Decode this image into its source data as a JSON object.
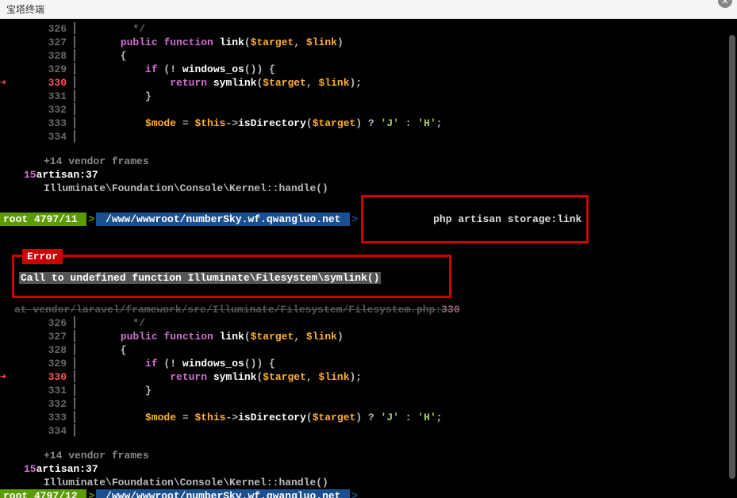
{
  "title_bar": {
    "title": "宝塔终端",
    "close_icon": "✕"
  },
  "code_block_1": {
    "lines": [
      {
        "num": "326",
        "arrow": false,
        "content": "        */"
      },
      {
        "num": "327",
        "arrow": false,
        "tokens": [
          {
            "t": "      ",
            "c": ""
          },
          {
            "t": "public",
            "c": "kw"
          },
          {
            "t": " ",
            "c": ""
          },
          {
            "t": "function",
            "c": "kw"
          },
          {
            "t": " ",
            "c": ""
          },
          {
            "t": "link",
            "c": "fn"
          },
          {
            "t": "(",
            "c": "punct"
          },
          {
            "t": "$target",
            "c": "var"
          },
          {
            "t": ", ",
            "c": "punct"
          },
          {
            "t": "$link",
            "c": "var"
          },
          {
            "t": ")",
            "c": "punct"
          }
        ]
      },
      {
        "num": "328",
        "arrow": false,
        "tokens": [
          {
            "t": "      {",
            "c": "punct"
          }
        ]
      },
      {
        "num": "329",
        "arrow": false,
        "tokens": [
          {
            "t": "          ",
            "c": ""
          },
          {
            "t": "if",
            "c": "kw"
          },
          {
            "t": " (! ",
            "c": "punct"
          },
          {
            "t": "windows_os",
            "c": "fn"
          },
          {
            "t": "()) {",
            "c": "punct"
          }
        ]
      },
      {
        "num": "330",
        "arrow": true,
        "tokens": [
          {
            "t": "              ",
            "c": ""
          },
          {
            "t": "return",
            "c": "kw"
          },
          {
            "t": " ",
            "c": ""
          },
          {
            "t": "symlink",
            "c": "fn"
          },
          {
            "t": "(",
            "c": "punct"
          },
          {
            "t": "$target",
            "c": "var"
          },
          {
            "t": ", ",
            "c": "punct"
          },
          {
            "t": "$link",
            "c": "var"
          },
          {
            "t": ");",
            "c": "punct"
          }
        ]
      },
      {
        "num": "331",
        "arrow": false,
        "tokens": [
          {
            "t": "          }",
            "c": "punct"
          }
        ]
      },
      {
        "num": "332",
        "arrow": false,
        "tokens": []
      },
      {
        "num": "333",
        "arrow": false,
        "tokens": [
          {
            "t": "          ",
            "c": ""
          },
          {
            "t": "$mode",
            "c": "var"
          },
          {
            "t": " = ",
            "c": "op"
          },
          {
            "t": "$this",
            "c": "var"
          },
          {
            "t": "->",
            "c": "op"
          },
          {
            "t": "isDirectory",
            "c": "fn"
          },
          {
            "t": "(",
            "c": "punct"
          },
          {
            "t": "$target",
            "c": "var"
          },
          {
            "t": ") ? ",
            "c": "punct"
          },
          {
            "t": "'J'",
            "c": "str"
          },
          {
            "t": " : ",
            "c": "punct"
          },
          {
            "t": "'H'",
            "c": "str"
          },
          {
            "t": ";",
            "c": "punct"
          }
        ]
      },
      {
        "num": "334",
        "arrow": false,
        "tokens": []
      }
    ]
  },
  "trace_1": {
    "frames": "+14 vendor frames",
    "frame_num": "15",
    "artisan": "artisan:37",
    "kernel": "Illuminate\\Foundation\\Console\\Kernel::handle()"
  },
  "prompt_1": {
    "user": "root 4797/11 ",
    "path": " /www/wwwroot/numberSky.wf.qwangluo.net ",
    "command": "php artisan storage:link"
  },
  "error": {
    "label": "Error",
    "message": "Call to undefined function Illuminate\\Filesystem\\symlink()",
    "at": "at vendor/laravel/framework/src/Illuminate/Filesystem/Filesystem.php:",
    "at_num": "330"
  },
  "trace_2": {
    "frames": "+14 vendor frames",
    "frame_num": "15",
    "artisan": "artisan:37",
    "kernel": "Illuminate\\Foundation\\Console\\Kernel::handle()"
  },
  "prompt_2": {
    "user": "root 4797/12 ",
    "path": " /www/wwwroot/numberSky.wf.qwangluo.net ",
    "command": ""
  }
}
